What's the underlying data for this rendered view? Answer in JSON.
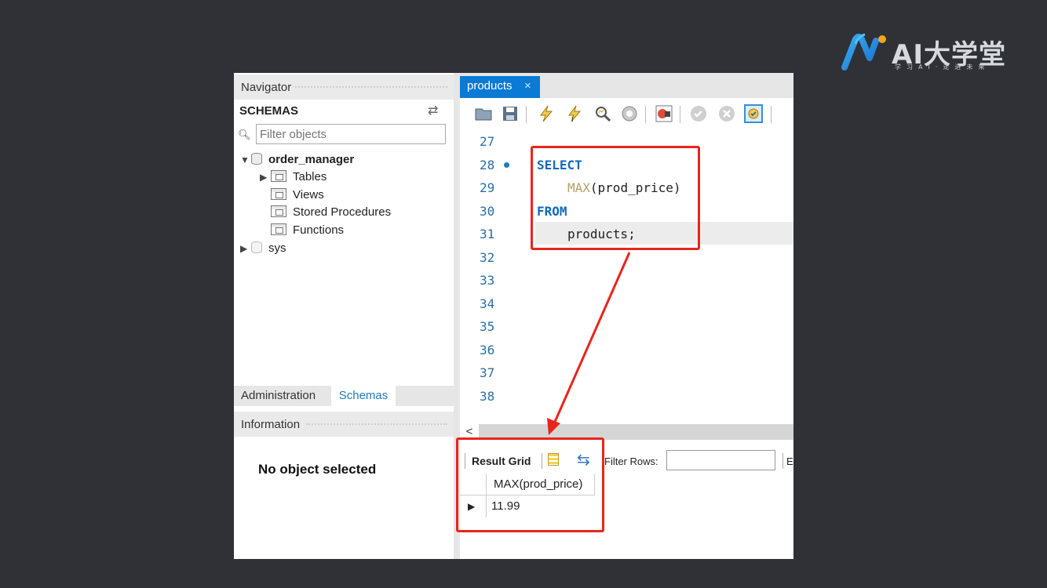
{
  "logo": {
    "text": "AI大学堂",
    "subtitle": "学习AI·走进未来"
  },
  "navigator": {
    "title": "Navigator",
    "schemas_title": "SCHEMAS",
    "filter_placeholder": "Filter objects",
    "tree": [
      {
        "label": "order_manager",
        "expanded": true
      },
      {
        "label": "Tables"
      },
      {
        "label": "Views"
      },
      {
        "label": "Stored Procedures"
      },
      {
        "label": "Functions"
      },
      {
        "label": "sys",
        "expanded": false
      }
    ],
    "bottom_tabs": [
      "Administration",
      "Schemas"
    ],
    "active_bottom_tab": "Schemas"
  },
  "information": {
    "title": "Information",
    "message": "No object selected"
  },
  "editor": {
    "tab_label": "products",
    "tab_close": "×",
    "lines": [
      {
        "num": "27"
      },
      {
        "num": "28",
        "breakpoint": true,
        "kw": "SELECT"
      },
      {
        "num": "29",
        "fn": "MAX",
        "text": "(prod_price)"
      },
      {
        "num": "30",
        "kw": "FROM"
      },
      {
        "num": "31",
        "text": "products;"
      },
      {
        "num": "32"
      },
      {
        "num": "33"
      },
      {
        "num": "34"
      },
      {
        "num": "35"
      },
      {
        "num": "36"
      },
      {
        "num": "37"
      },
      {
        "num": "38"
      }
    ],
    "scroll_left": "<"
  },
  "results": {
    "result_grid_label": "Result Grid",
    "filter_rows_label": "Filter Rows:",
    "trailing_label": "E",
    "column": "MAX(prod_price)",
    "value": "11.99"
  },
  "colors": {
    "accent": "#0a7ad4",
    "highlight": "#e8251d",
    "background": "#2f3136"
  }
}
